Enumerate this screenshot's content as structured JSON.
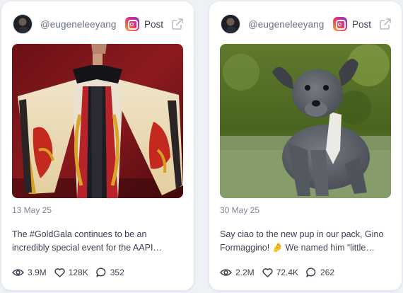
{
  "posts": [
    {
      "handle": "@eugeneleeyang",
      "platform_icon": "instagram-icon",
      "post_type": "Post",
      "media_alt": "figure in black-and-red gown with wide painted sleeves",
      "date": "13 May 25",
      "caption": "The #GoldGala continues to be an incredibly special event for the AAPI…",
      "views": "3.9M",
      "likes": "128K",
      "comments": "352"
    },
    {
      "handle": "@eugeneleeyang",
      "platform_icon": "instagram-icon",
      "post_type": "Post",
      "media_alt": "grey scruffy puppy sitting on grass",
      "date": "30 May 25",
      "caption": "Say ciao to the new pup in our pack, Gino Formaggino! 🤌 We named him “little…",
      "views": "2.2M",
      "likes": "72.4K",
      "comments": "262"
    }
  ],
  "colors": {
    "accent_text": "#3b4252",
    "muted_text": "#7c8596",
    "card_bg": "#ffffff",
    "page_bg": "#eef1f5"
  }
}
